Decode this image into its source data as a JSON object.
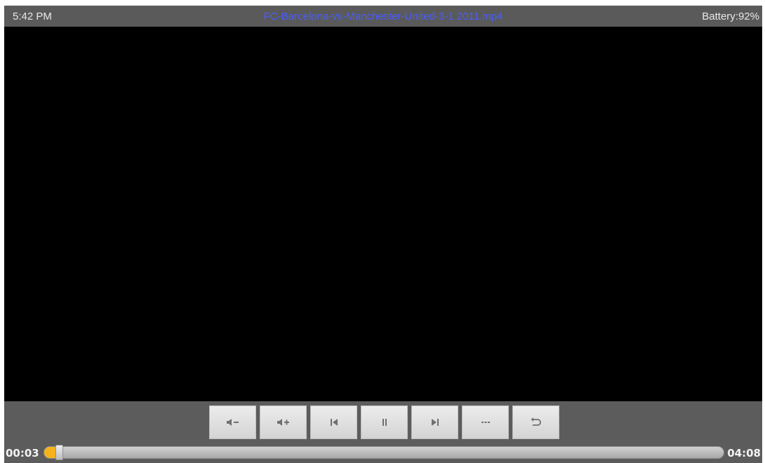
{
  "status_bar": {
    "time": "5:42 PM",
    "title": "FC-Barcelona-vs-Manchester-United-3-1 2011.mp4",
    "battery": "Battery:92%"
  },
  "playback": {
    "current_time": "00:03",
    "total_time": "04:08",
    "progress_fraction": 0.012
  },
  "controls": [
    {
      "name": "volume-down-icon"
    },
    {
      "name": "volume-up-icon"
    },
    {
      "name": "previous-icon"
    },
    {
      "name": "pause-icon"
    },
    {
      "name": "next-icon"
    },
    {
      "name": "more-icon"
    },
    {
      "name": "return-icon"
    }
  ],
  "colors": {
    "title": "#4a5cff",
    "progress": "#f5b21b"
  }
}
